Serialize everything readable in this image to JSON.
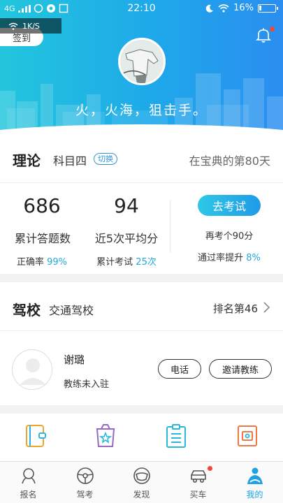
{
  "status_bar": {
    "network": "4G",
    "time": "22:10",
    "battery": "16%",
    "battery_level": 0.16,
    "net_speed": "1K/S"
  },
  "header": {
    "signin_label": "签到",
    "motto": "火，火海，狙击手。"
  },
  "theory": {
    "title": "理论",
    "subject": "科目四",
    "switch_label": "切换",
    "day_text": "在宝典的第80天",
    "answered_count": "686",
    "answered_label": "累计答题数",
    "accuracy_prefix": "正确率",
    "accuracy_value": "99%",
    "avg_score": "94",
    "avg_label": "近5次平均分",
    "exams_prefix": "累计考试",
    "exams_value": "25次",
    "exam_button": "去考试",
    "retake_note": "再考个90分",
    "pass_prefix": "通过率提升",
    "pass_value": "8%"
  },
  "school": {
    "title": "驾校",
    "name": "交通驾校",
    "rank": "排名第46",
    "coach_name": "谢璐",
    "coach_status": "教练未入驻",
    "call_button": "电话",
    "invite_button": "邀请教练"
  },
  "quick_icons": [
    "notebook-icon",
    "star-bag-icon",
    "clipboard-icon",
    "certificate-icon"
  ],
  "tabs": [
    {
      "label": "报名",
      "icon": "signup-icon"
    },
    {
      "label": "驾考",
      "icon": "steering-wheel-icon"
    },
    {
      "label": "发现",
      "icon": "discover-icon"
    },
    {
      "label": "买车",
      "icon": "car-icon"
    },
    {
      "label": "我的",
      "icon": "profile-icon"
    }
  ],
  "colors": {
    "accent": "#1fa2e2",
    "highlight": "#22a9d8",
    "badge": "#f2463b"
  }
}
